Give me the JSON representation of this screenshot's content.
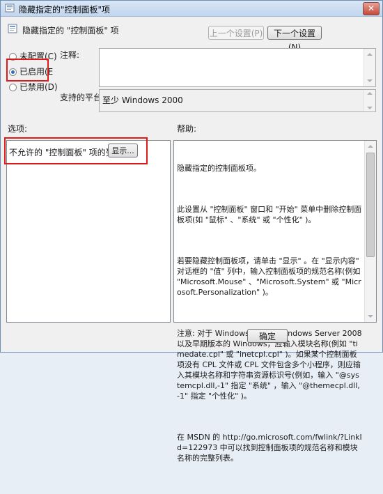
{
  "window": {
    "title": "隐藏指定的\"控制面板\"项",
    "close_label": "✕"
  },
  "header": {
    "title": "隐藏指定的 \"控制面板\" 项"
  },
  "nav": {
    "prev_label": "上一个设置(P)",
    "next_label": "下一个设置(N)"
  },
  "state": {
    "options": [
      {
        "label": "未配置(C)",
        "checked": false
      },
      {
        "label": "已启用(E",
        "checked": true
      },
      {
        "label": "已禁用(D)",
        "checked": false
      }
    ]
  },
  "comment": {
    "label": "注释:",
    "value": ""
  },
  "platform": {
    "label": "支持的平台:",
    "value": "至少 Windows 2000"
  },
  "options_section": {
    "label": "选项:",
    "list_label": "不允许的 \"控制面板\" 项的列表",
    "show_button": "显示..."
  },
  "help_section": {
    "label": "帮助:",
    "paragraphs": [
      "隐藏指定的控制面板项。",
      "此设置从 \"控制面板\" 窗口和 \"开始\" 菜单中删除控制面板项(如 \"鼠标\" 、\"系统\" 或 \"个性化\" )。",
      "若要隐藏控制面板项，请单击 \"显示\" 。在 \"显示内容\" 对话框的 \"值\" 列中，输入控制面板项的规范名称(例如 \"Microsoft.Mouse\" 、\"Microsoft.System\" 或 \"Microsoft.Personalization\" )。",
      "注意: 对于 Windows Vista、Windows Server 2008 以及早期版本的 Windows，应输入模块名称(例如 \"timedate.cpl\" 或 \"inetcpl.cpl\" )。如果某个控制面板项没有 CPL 文件或 CPL 文件包含多个小程序，则应输入其模块名称和字符串资源标识号(例如，输入 \"@systemcpl.dll,-1\" 指定 \"系统\" ，输入 \"@themecpl.dll,-1\" 指定 \"个性化\" )。",
      "在 MSDN 的 http://go.microsoft.com/fwlink/?LinkId=122973 中可以找到控制面板项的规范名称和模块名称的完整列表。"
    ]
  },
  "footer": {
    "ok_label": "确定"
  },
  "colors": {
    "highlight": "#e01919",
    "title_bar": "#c2d6ee"
  },
  "icons": [
    "policy-icon",
    "close-icon",
    "radio-icon",
    "scroll-up-icon",
    "scroll-down-icon"
  ]
}
